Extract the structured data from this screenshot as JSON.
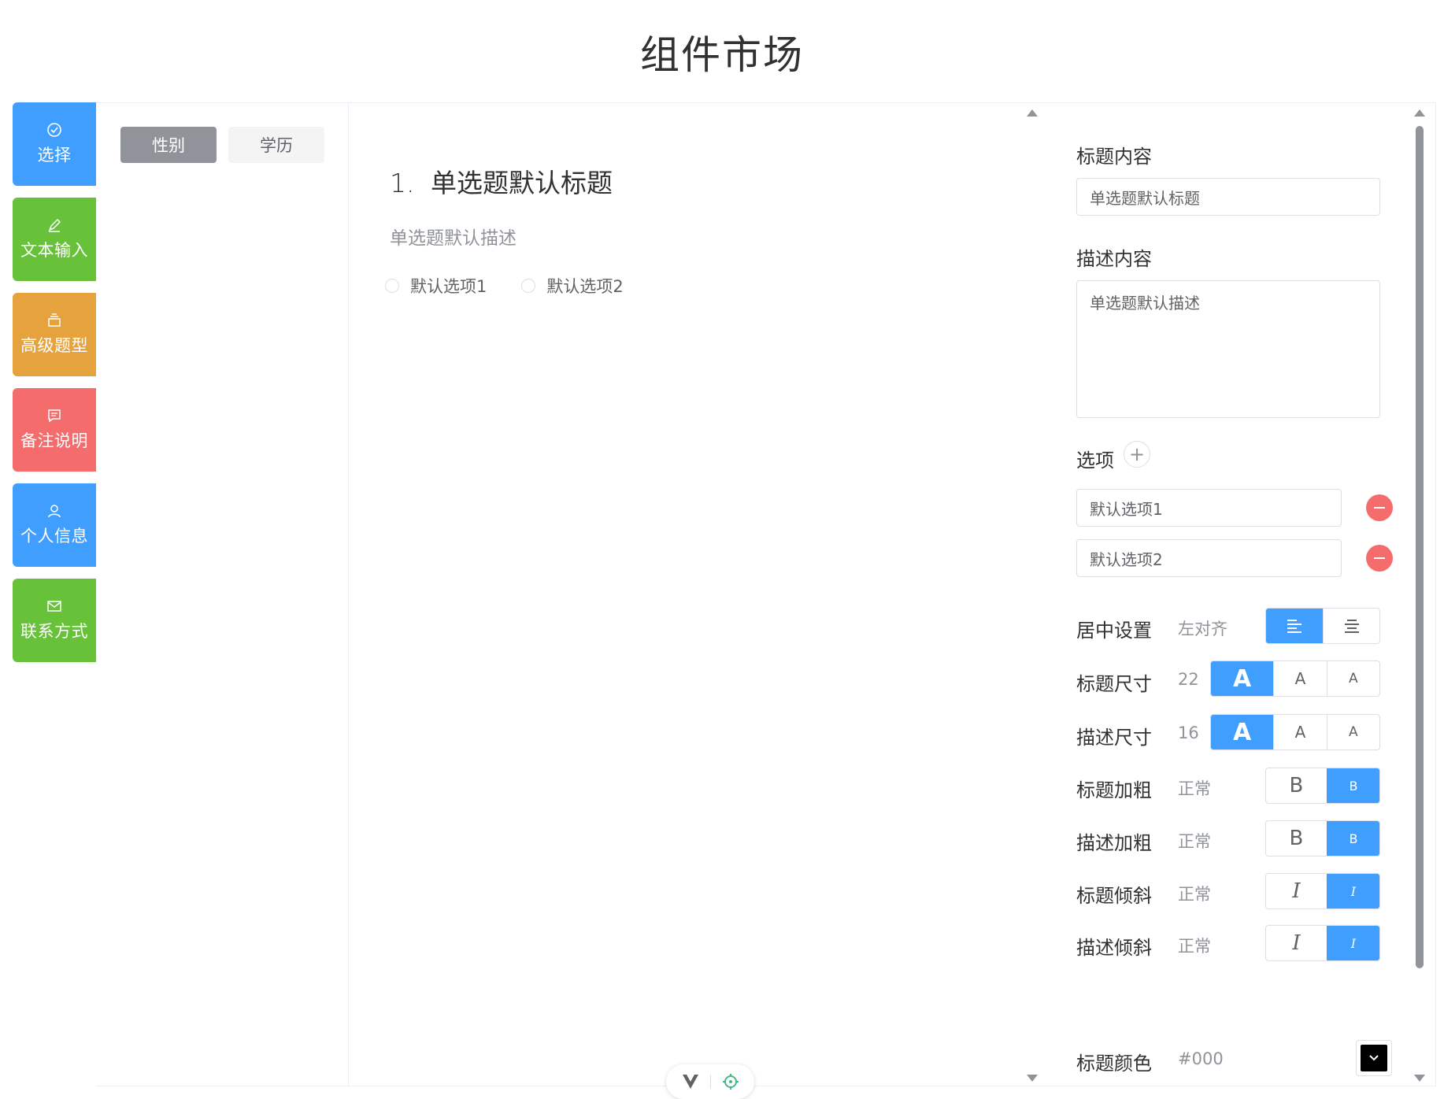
{
  "page_title": "组件市场",
  "categories": [
    {
      "label": "选择",
      "color": "#409eff",
      "icon": "check-circle-icon"
    },
    {
      "label": "文本输入",
      "color": "#67c23a",
      "icon": "pencil-icon"
    },
    {
      "label": "高级题型",
      "color": "#e6a23c",
      "icon": "stack-icon"
    },
    {
      "label": "备注说明",
      "color": "#f56c6c",
      "icon": "comment-icon"
    },
    {
      "label": "个人信息",
      "color": "#409eff",
      "icon": "user-icon"
    },
    {
      "label": "联系方式",
      "color": "#67c23a",
      "icon": "mail-icon"
    }
  ],
  "tabs": [
    {
      "label": "性别",
      "active": true
    },
    {
      "label": "学历",
      "active": false
    }
  ],
  "preview": {
    "number": "1.",
    "title": "单选题默认标题",
    "description": "单选题默认描述",
    "options": [
      "默认选项1",
      "默认选项2"
    ]
  },
  "settings": {
    "title_label": "标题内容",
    "title_value": "单选题默认标题",
    "desc_label": "描述内容",
    "desc_value": "单选题默认描述",
    "options_label": "选项",
    "options": [
      "默认选项1",
      "默认选项2"
    ],
    "align": {
      "label": "居中设置",
      "value": "左对齐"
    },
    "title_size": {
      "label": "标题尺寸",
      "value": "22",
      "buttons": [
        "A",
        "A",
        "A"
      ]
    },
    "desc_size": {
      "label": "描述尺寸",
      "value": "16",
      "buttons": [
        "A",
        "A",
        "A"
      ]
    },
    "title_bold": {
      "label": "标题加粗",
      "value": "正常",
      "buttons": [
        "B",
        "B"
      ]
    },
    "desc_bold": {
      "label": "描述加粗",
      "value": "正常",
      "buttons": [
        "B",
        "B"
      ]
    },
    "title_italic": {
      "label": "标题倾斜",
      "value": "正常",
      "buttons": [
        "I",
        "I"
      ]
    },
    "desc_italic": {
      "label": "描述倾斜",
      "value": "正常",
      "buttons": [
        "I",
        "I"
      ]
    },
    "title_color": {
      "label": "标题颜色",
      "value": "#000"
    }
  },
  "colors": {
    "primary": "#409eff",
    "success": "#67c23a",
    "warning": "#e6a23c",
    "danger": "#f56c6c",
    "info": "#909399"
  }
}
